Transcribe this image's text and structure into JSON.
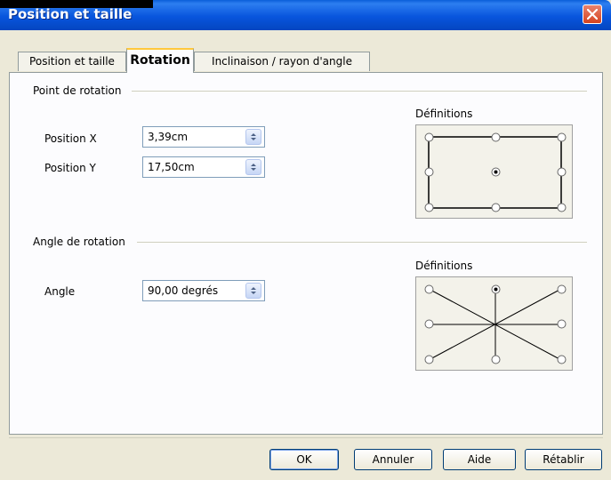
{
  "window": {
    "title": "Position et taille"
  },
  "tabs": [
    {
      "label": "Position et taille",
      "active": false
    },
    {
      "label": "Rotation",
      "active": true
    },
    {
      "label": "Inclinaison / rayon d'angle",
      "active": false
    }
  ],
  "pivot": {
    "group_label": "Point de rotation",
    "position_x": {
      "label": "Position X",
      "mnemonic": "X",
      "value": "3,39cm"
    },
    "position_y": {
      "label": "Position Y",
      "mnemonic": "Y",
      "value": "17,50cm"
    },
    "definitions_label": "Définitions",
    "selected_point": "center"
  },
  "rotation": {
    "group_label": "Angle de rotation",
    "angle": {
      "label": "Angle",
      "mnemonic": "A",
      "value": "90,00 degrés"
    },
    "definitions_label": "Définitions",
    "selected_point": "top-center"
  },
  "buttons": {
    "ok": "OK",
    "cancel": "Annuler",
    "help": "Aide",
    "reset": "Rétablir"
  },
  "colors": {
    "titlebar": "#0855dd",
    "active_tab_accent": "#ffc83c",
    "dialog_bg": "#ece9d8",
    "close_button": "#d6431f"
  }
}
